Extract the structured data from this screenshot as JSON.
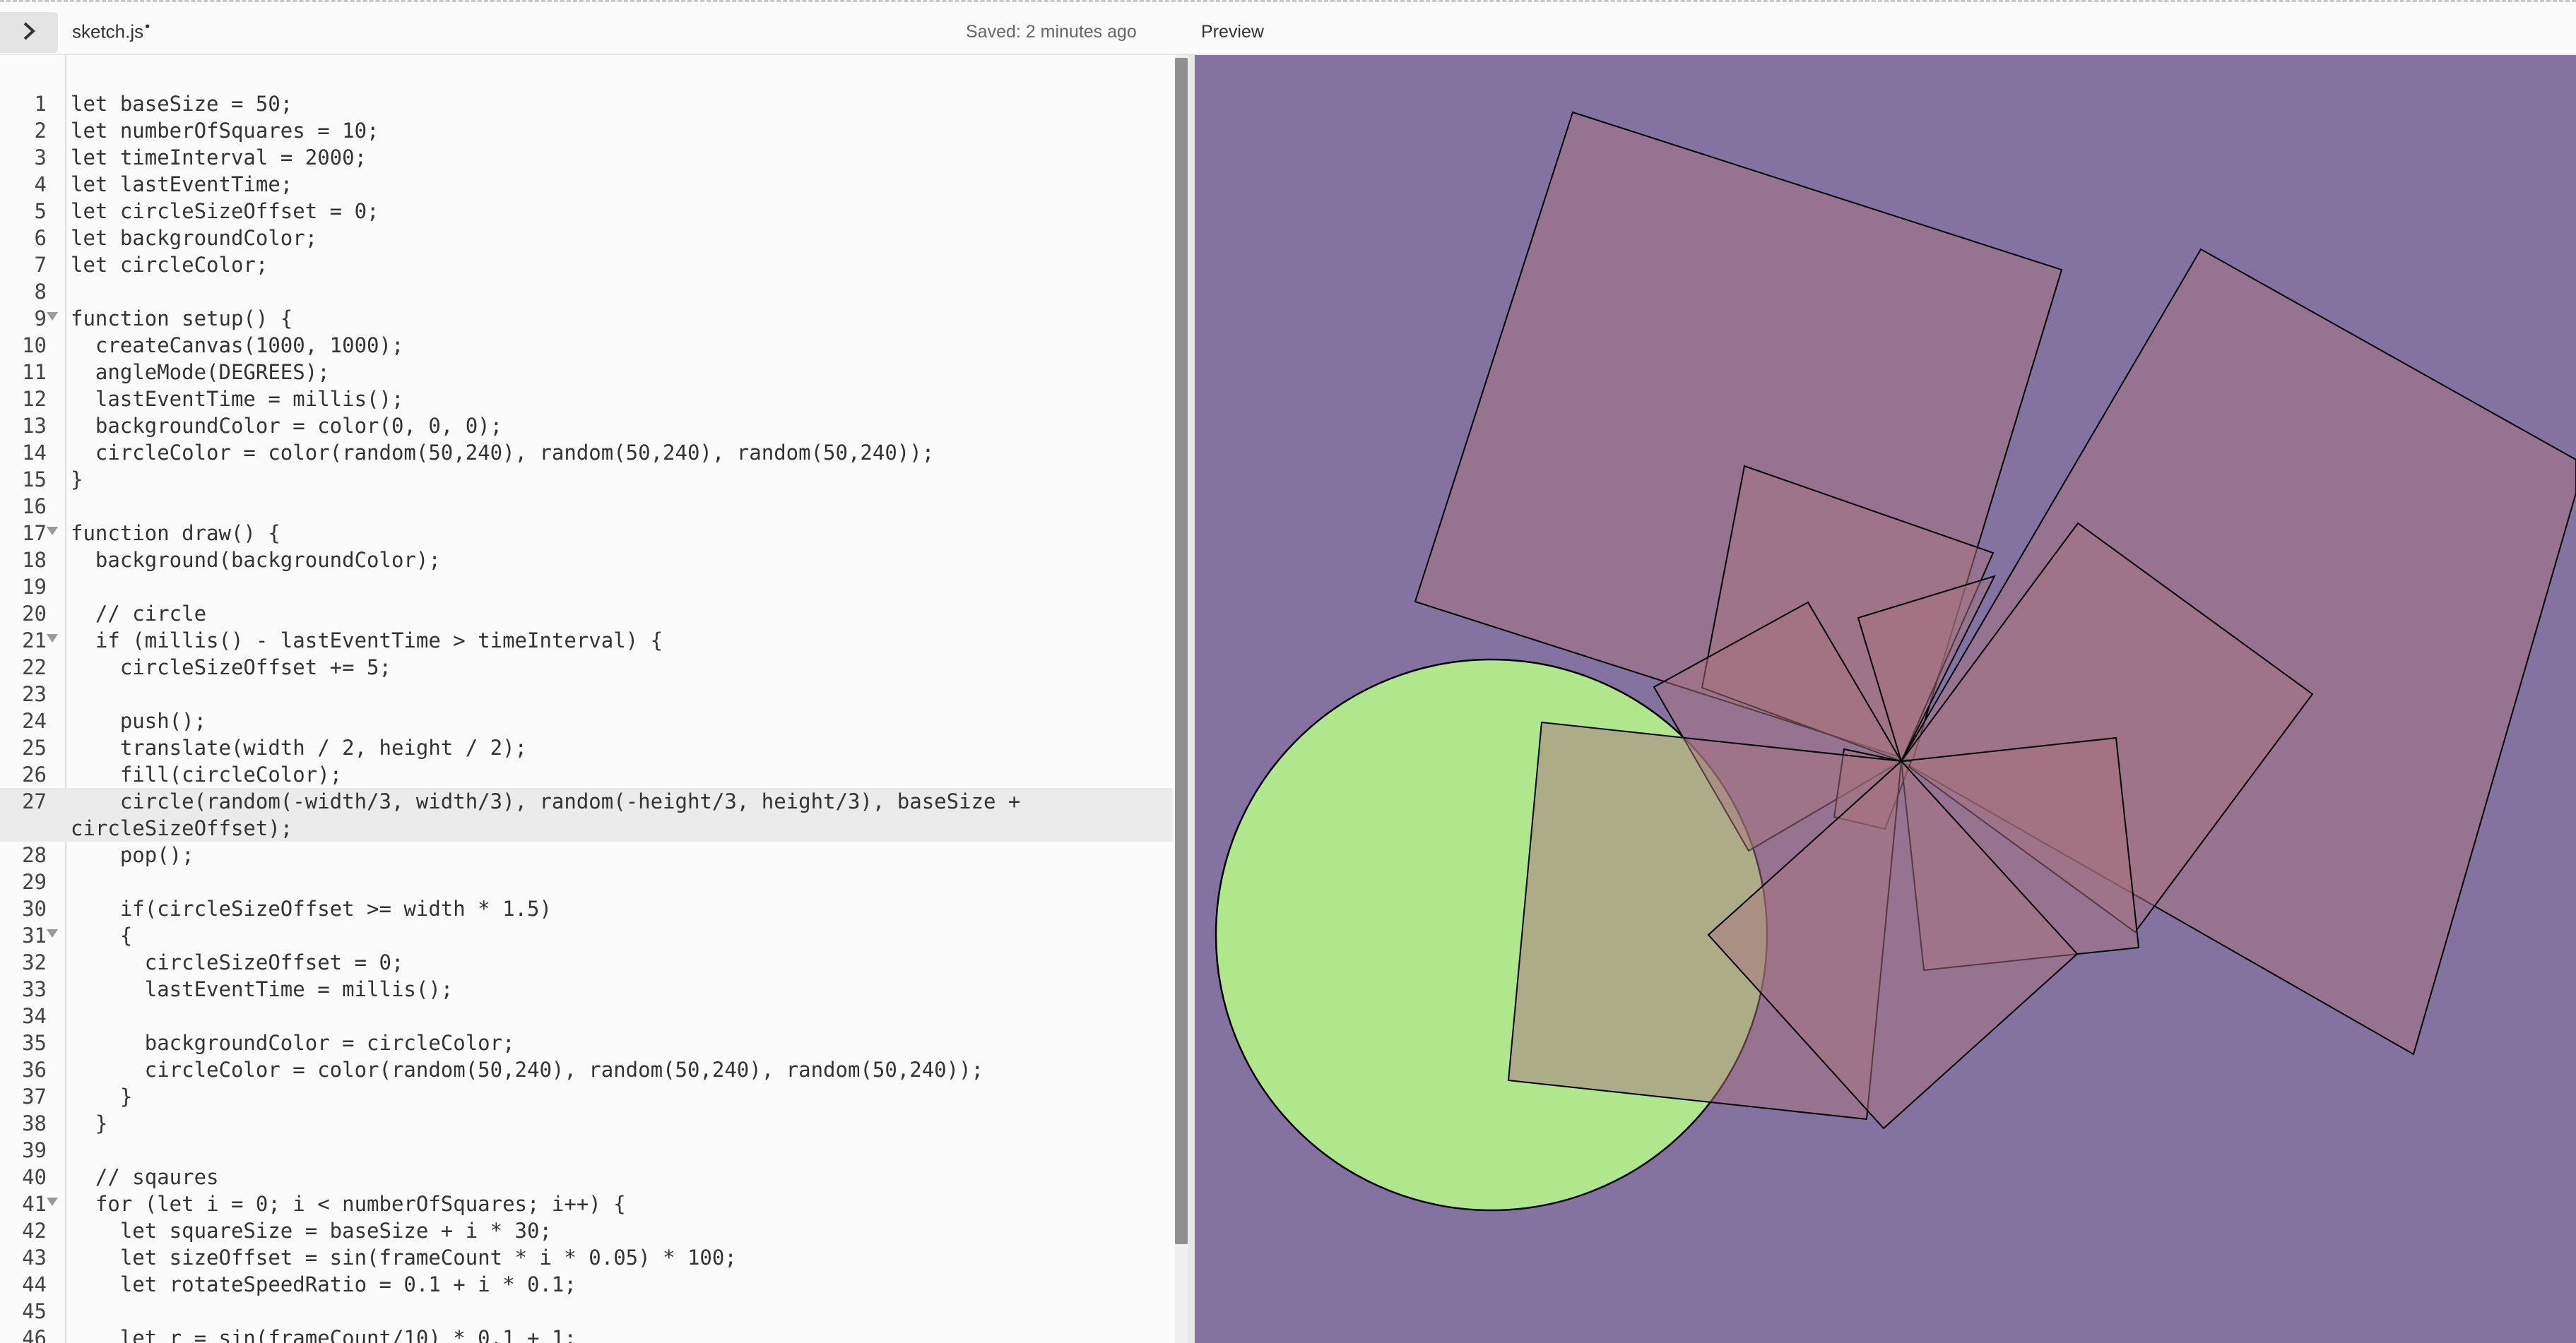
{
  "header": {
    "toggle_icon": "chevron-right-icon",
    "filename": "sketch.js",
    "unsaved_marker": "•",
    "saved_status": "Saved: 2 minutes ago",
    "preview_label": "Preview"
  },
  "editor": {
    "active_line": 27,
    "lines": [
      {
        "n": "1",
        "text": "let baseSize = 50;"
      },
      {
        "n": "2",
        "text": "let numberOfSquares = 10;"
      },
      {
        "n": "3",
        "text": "let timeInterval = 2000;"
      },
      {
        "n": "4",
        "text": "let lastEventTime;"
      },
      {
        "n": "5",
        "text": "let circleSizeOffset = 0;"
      },
      {
        "n": "6",
        "text": "let backgroundColor;"
      },
      {
        "n": "7",
        "text": "let circleColor;"
      },
      {
        "n": "8",
        "text": ""
      },
      {
        "n": "9",
        "text": "function setup() {",
        "fold": true
      },
      {
        "n": "10",
        "text": "  createCanvas(1000, 1000);"
      },
      {
        "n": "11",
        "text": "  angleMode(DEGREES);"
      },
      {
        "n": "12",
        "text": "  lastEventTime = millis();"
      },
      {
        "n": "13",
        "text": "  backgroundColor = color(0, 0, 0);"
      },
      {
        "n": "14",
        "text": "  circleColor = color(random(50,240), random(50,240), random(50,240));"
      },
      {
        "n": "15",
        "text": "}"
      },
      {
        "n": "16",
        "text": ""
      },
      {
        "n": "17",
        "text": "function draw() {",
        "fold": true
      },
      {
        "n": "18",
        "text": "  background(backgroundColor);"
      },
      {
        "n": "19",
        "text": ""
      },
      {
        "n": "20",
        "text": "  // circle"
      },
      {
        "n": "21",
        "text": "  if (millis() - lastEventTime > timeInterval) {",
        "fold": true
      },
      {
        "n": "22",
        "text": "    circleSizeOffset += 5;"
      },
      {
        "n": "23",
        "text": ""
      },
      {
        "n": "24",
        "text": "    push();"
      },
      {
        "n": "25",
        "text": "    translate(width / 2, height / 2);"
      },
      {
        "n": "26",
        "text": "    fill(circleColor);"
      },
      {
        "n": "27",
        "text": "    circle(random(-width/3, width/3), random(-height/3, height/3), baseSize +"
      },
      {
        "n": "",
        "text": "circleSizeOffset);"
      },
      {
        "n": "28",
        "text": "    pop();"
      },
      {
        "n": "29",
        "text": ""
      },
      {
        "n": "30",
        "text": "    if(circleSizeOffset >= width * 1.5)"
      },
      {
        "n": "31",
        "text": "    {",
        "fold": true
      },
      {
        "n": "32",
        "text": "      circleSizeOffset = 0;"
      },
      {
        "n": "33",
        "text": "      lastEventTime = millis();"
      },
      {
        "n": "34",
        "text": ""
      },
      {
        "n": "35",
        "text": "      backgroundColor = circleColor;"
      },
      {
        "n": "36",
        "text": "      circleColor = color(random(50,240), random(50,240), random(50,240));"
      },
      {
        "n": "37",
        "text": "    }"
      },
      {
        "n": "38",
        "text": "  }"
      },
      {
        "n": "39",
        "text": ""
      },
      {
        "n": "40",
        "text": "  // sqaures"
      },
      {
        "n": "41",
        "text": "  for (let i = 0; i < numberOfSquares; i++) {",
        "fold": true
      },
      {
        "n": "42",
        "text": "    let squareSize = baseSize + i * 30;"
      },
      {
        "n": "43",
        "text": "    let sizeOffset = sin(frameCount * i * 0.05) * 100;"
      },
      {
        "n": "44",
        "text": "    let rotateSpeedRatio = 0.1 + i * 0.1;"
      },
      {
        "n": "45",
        "text": ""
      },
      {
        "n": "46",
        "text": "    let r = sin(frameCount/10) * 0.1 + 1;"
      }
    ]
  },
  "preview": {
    "background_color": "#8473a0",
    "circle_color": "#b0e68c",
    "square_fill": "#a7737f",
    "stroke_color": "#000000"
  }
}
